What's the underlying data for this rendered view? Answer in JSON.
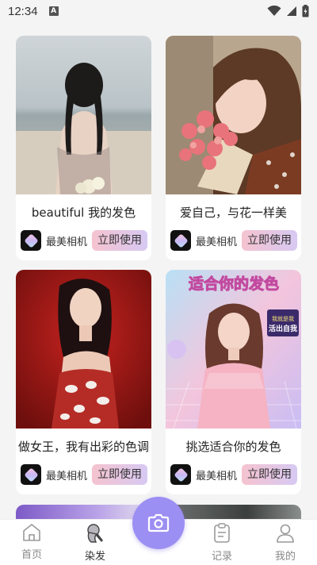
{
  "status_bar": {
    "time": "12:34",
    "notification_icon": "A"
  },
  "cards": [
    {
      "title": "beautiful 我的发色",
      "app_name": "最美相机",
      "button_label": "立即使用",
      "image": "photo-girl-braids-beach"
    },
    {
      "title": "爱自己，与花一样美",
      "app_name": "最美相机",
      "button_label": "立即使用",
      "image": "photo-girl-flowers"
    },
    {
      "title": "做女王，我有出彩的色调",
      "app_name": "最美相机",
      "button_label": "立即使用",
      "image": "photo-girl-red-dress"
    },
    {
      "title": "挑选适合你的发色",
      "app_name": "最美相机",
      "button_label": "立即使用",
      "image": "photo-girl-pink-poster",
      "poster_headline": "适合你的发色",
      "poster_badge_top": "我就是我",
      "poster_badge_bottom": "活出自我"
    }
  ],
  "bottom_nav": {
    "items": [
      {
        "label": "首页",
        "icon": "home-icon"
      },
      {
        "label": "染发",
        "icon": "hair-dye-icon",
        "active": true
      },
      {
        "label": "记录",
        "icon": "clipboard-icon"
      },
      {
        "label": "我的",
        "icon": "person-icon"
      }
    ],
    "center_button_icon": "camera-icon"
  },
  "colors": {
    "accent": "#9b8ff3",
    "button_gradient_start": "#f5c3cf",
    "button_gradient_end": "#d7c9f3"
  }
}
